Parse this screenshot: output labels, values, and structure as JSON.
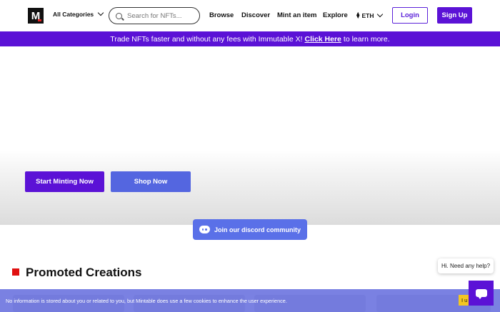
{
  "header": {
    "logo_letter": "M",
    "categories_label": "All Categories",
    "search": {
      "placeholder": "Search for NFTs..."
    },
    "nav": [
      "Browse",
      "Discover",
      "Mint an item",
      "Explore"
    ],
    "currency": "ETH",
    "login_label": "Login",
    "signup_label": "Sign Up"
  },
  "promo_bar": {
    "text_before": "Trade NFTs faster and without any fees with Immutable X!",
    "link_text": "Click Here",
    "text_after": "to learn more."
  },
  "hero": {
    "mint_button": "Start Minting Now",
    "shop_button": "Shop Now",
    "discord_button": "Join our discord community"
  },
  "promoted": {
    "title": "Promoted Creations"
  },
  "cookie_banner": {
    "text": "No information is stored about you or related to you, but Mintable does use a few cookies to enhance the user experience.",
    "accept_label": "I u"
  },
  "chat": {
    "greeting": "Hi. Need any help?"
  },
  "colors": {
    "brand_purple": "#5b12d6",
    "shop_blue": "#5466e0",
    "discord_blue": "#5a70e8",
    "accent_red": "#e01010",
    "cookie_yellow": "#f3c623"
  }
}
